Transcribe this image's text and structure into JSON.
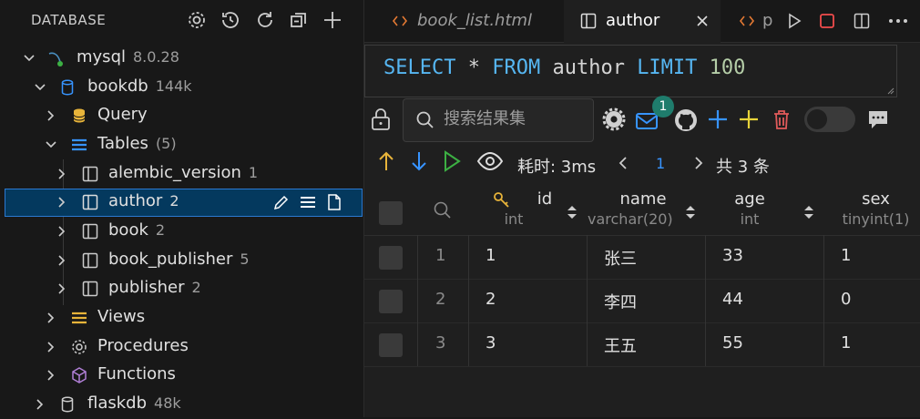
{
  "sidebar": {
    "title": "DATABASE",
    "tree": {
      "server": {
        "label": "mysql",
        "count": "8.0.28"
      },
      "db": {
        "label": "bookdb",
        "count": "144k"
      },
      "query": {
        "label": "Query"
      },
      "tables": {
        "label": "Tables",
        "count": "(5)"
      },
      "table_items": [
        {
          "label": "alembic_version",
          "count": "1"
        },
        {
          "label": "author",
          "count": "2"
        },
        {
          "label": "book",
          "count": "2"
        },
        {
          "label": "book_publisher",
          "count": "5"
        },
        {
          "label": "publisher",
          "count": "2"
        }
      ],
      "views": {
        "label": "Views"
      },
      "procedures": {
        "label": "Procedures"
      },
      "functions": {
        "label": "Functions"
      },
      "db2": {
        "label": "flaskdb",
        "count": "48k"
      }
    }
  },
  "tabs": [
    {
      "label": "book_list.html"
    },
    {
      "label": "author"
    },
    {
      "label": "p"
    }
  ],
  "editor": {
    "sql_kw1": "SELECT",
    "sql_mid": " * ",
    "sql_kw2": "FROM",
    "sql_table": " author ",
    "sql_kw3": "LIMIT",
    "sql_num": " 100"
  },
  "toolbar": {
    "search_placeholder": "搜索结果集",
    "badge": "1",
    "time": "耗时: 3ms",
    "page": "1",
    "total": "共 3 条"
  },
  "columns": [
    {
      "name": "id",
      "type": "int"
    },
    {
      "name": "name",
      "type": "varchar(20)"
    },
    {
      "name": "age",
      "type": "int"
    },
    {
      "name": "sex",
      "type": "tinyint(1)"
    }
  ],
  "rows": [
    {
      "n": "1",
      "id": "1",
      "name": "张三",
      "age": "33",
      "sex": "1"
    },
    {
      "n": "2",
      "id": "2",
      "name": "李四",
      "age": "44",
      "sex": "0"
    },
    {
      "n": "3",
      "id": "3",
      "name": "王五",
      "age": "55",
      "sex": "1"
    }
  ],
  "colors": {
    "accent": "#2b79d1",
    "keyword": "#56b6f2",
    "number": "#b5cea8",
    "badge": "#1f7c6c"
  }
}
